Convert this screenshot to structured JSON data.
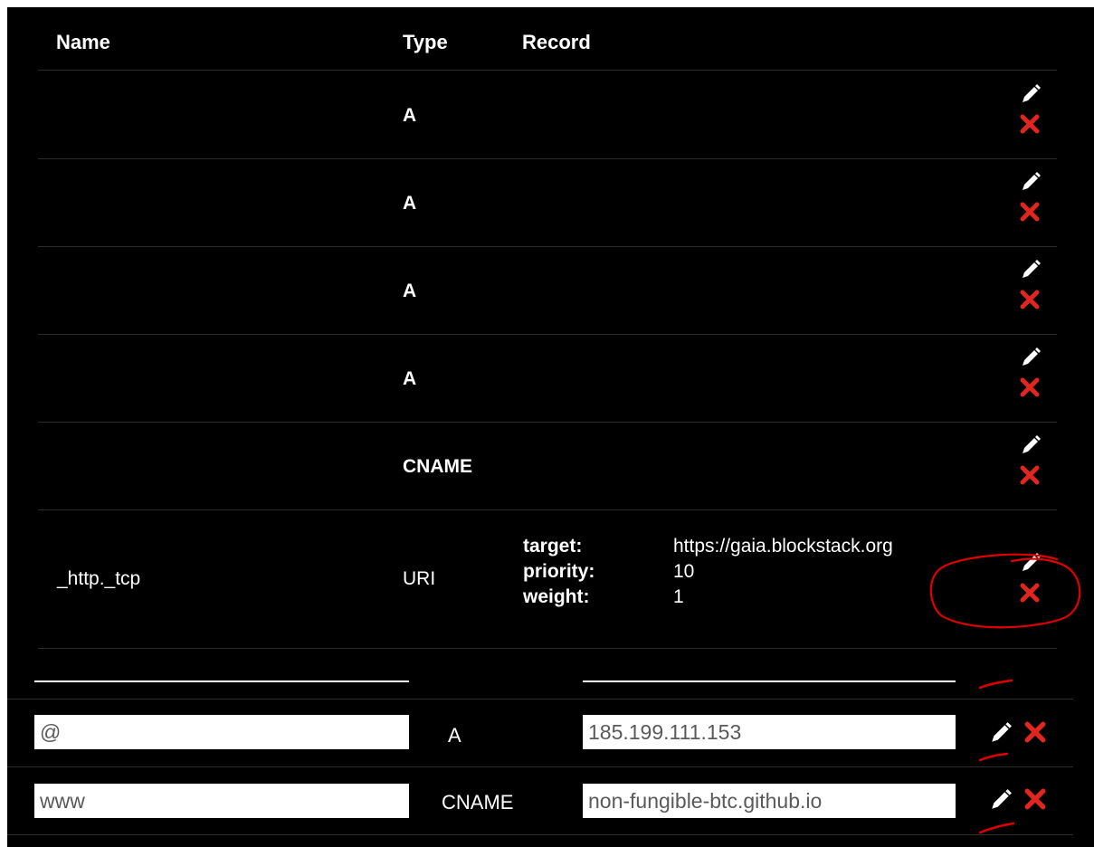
{
  "columns": {
    "name": "Name",
    "type": "Type",
    "record": "Record"
  },
  "records": [
    {
      "name": "",
      "type": "A"
    },
    {
      "name": "",
      "type": "A"
    },
    {
      "name": "",
      "type": "A"
    },
    {
      "name": "",
      "type": "A"
    },
    {
      "name": "",
      "type": "CNAME"
    },
    {
      "name": "_http._tcp",
      "type": "URI",
      "target_label": "target:",
      "target_value": "https://gaia.blockstack.org",
      "priority_label": "priority:",
      "priority_value": "10",
      "weight_label": "weight:",
      "weight_value": "1"
    }
  ],
  "new_records": [
    {
      "name": "@",
      "type": "A",
      "record": "185.199.111.153"
    },
    {
      "name": "www",
      "type": "CNAME",
      "record": "non-fungible-btc.github.io"
    }
  ],
  "icons": {
    "edit": "pencil-icon",
    "delete": "close-icon"
  },
  "colors": {
    "background": "#000000",
    "text": "#ffffff",
    "delete": "#e0261f",
    "annotation": "#e00000"
  }
}
